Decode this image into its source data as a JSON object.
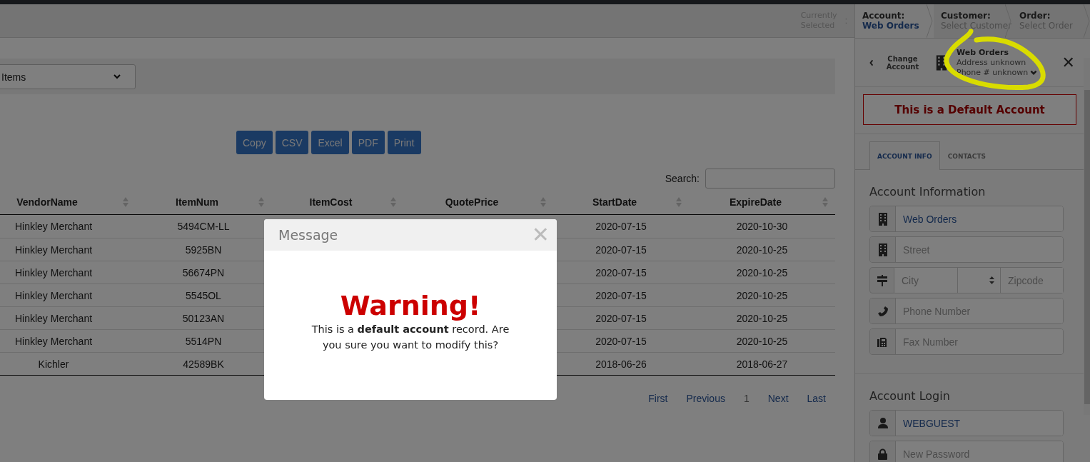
{
  "header": {
    "currently_selected": "Currently Selected",
    "separator": ":"
  },
  "filter": {
    "value": "Items"
  },
  "export_buttons": [
    "Copy",
    "CSV",
    "Excel",
    "PDF",
    "Print"
  ],
  "search": {
    "label": "Search:"
  },
  "table": {
    "columns": [
      "VendorName",
      "ItemNum",
      "ItemCost",
      "QuotePrice",
      "StartDate",
      "ExpireDate"
    ],
    "rows": [
      {
        "vendor": "Hinkley Merchant",
        "item_num": "5494CM-LL",
        "start_date": "2020-07-15",
        "expire_date": "2020-10-30"
      },
      {
        "vendor": "Hinkley Merchant",
        "item_num": "5925BN",
        "start_date": "2020-07-15",
        "expire_date": "2020-10-25"
      },
      {
        "vendor": "Hinkley Merchant",
        "item_num": "56674PN",
        "start_date": "2020-07-15",
        "expire_date": "2020-10-25"
      },
      {
        "vendor": "Hinkley Merchant",
        "item_num": "5545OL",
        "start_date": "2020-07-15",
        "expire_date": "2020-10-25"
      },
      {
        "vendor": "Hinkley Merchant",
        "item_num": "50123AN",
        "start_date": "2020-07-15",
        "expire_date": "2020-10-25"
      },
      {
        "vendor": "Hinkley Merchant",
        "item_num": "5514PN",
        "start_date": "2020-07-15",
        "expire_date": "2020-10-25"
      },
      {
        "vendor": "Kichler",
        "item_num": "42589BK",
        "start_date": "2018-06-26",
        "expire_date": "2018-06-27"
      }
    ]
  },
  "pagination": [
    {
      "label": "First",
      "selected": false
    },
    {
      "label": "Previous",
      "selected": false
    },
    {
      "label": "1",
      "selected": true
    },
    {
      "label": "Next",
      "selected": false
    },
    {
      "label": "Last",
      "selected": false
    }
  ],
  "breadcrumb": [
    {
      "label": "Account:",
      "value": "Web Orders",
      "selected": true
    },
    {
      "label": "Customer:",
      "value": "Select Customer",
      "selected": false
    },
    {
      "label": "Order:",
      "value": "Select Order",
      "selected": false
    }
  ],
  "account_card": {
    "back_label": "Change Account",
    "name": "Web Orders",
    "address": "Address unknown",
    "phone": "Phone # unknown"
  },
  "close_symbol": "✕",
  "default_banner": "This is a Default Account",
  "tabs": [
    {
      "label": "ACCOUNT INFO",
      "selected": true
    },
    {
      "label": "CONTACTS",
      "selected": false
    }
  ],
  "sections": [
    {
      "title": "Account Information",
      "fields": [
        {
          "kind": "name",
          "value": "Web Orders"
        },
        {
          "kind": "street",
          "placeholder": "Street"
        },
        {
          "kind": "city",
          "placeholder": "City",
          "zip_placeholder": "Zipcode"
        },
        {
          "kind": "phone",
          "placeholder": "Phone Number"
        },
        {
          "kind": "fax",
          "placeholder": "Fax Number"
        }
      ]
    },
    {
      "title": "Account Login",
      "fields": [
        {
          "kind": "username",
          "value": "WEBGUEST"
        },
        {
          "kind": "password",
          "placeholder": "New Password"
        }
      ]
    }
  ],
  "modal": {
    "title": "Message",
    "close_symbol": "✕",
    "heading": "Warning!",
    "body": "This is a **default account** record. Are you sure you want to modify this?"
  }
}
